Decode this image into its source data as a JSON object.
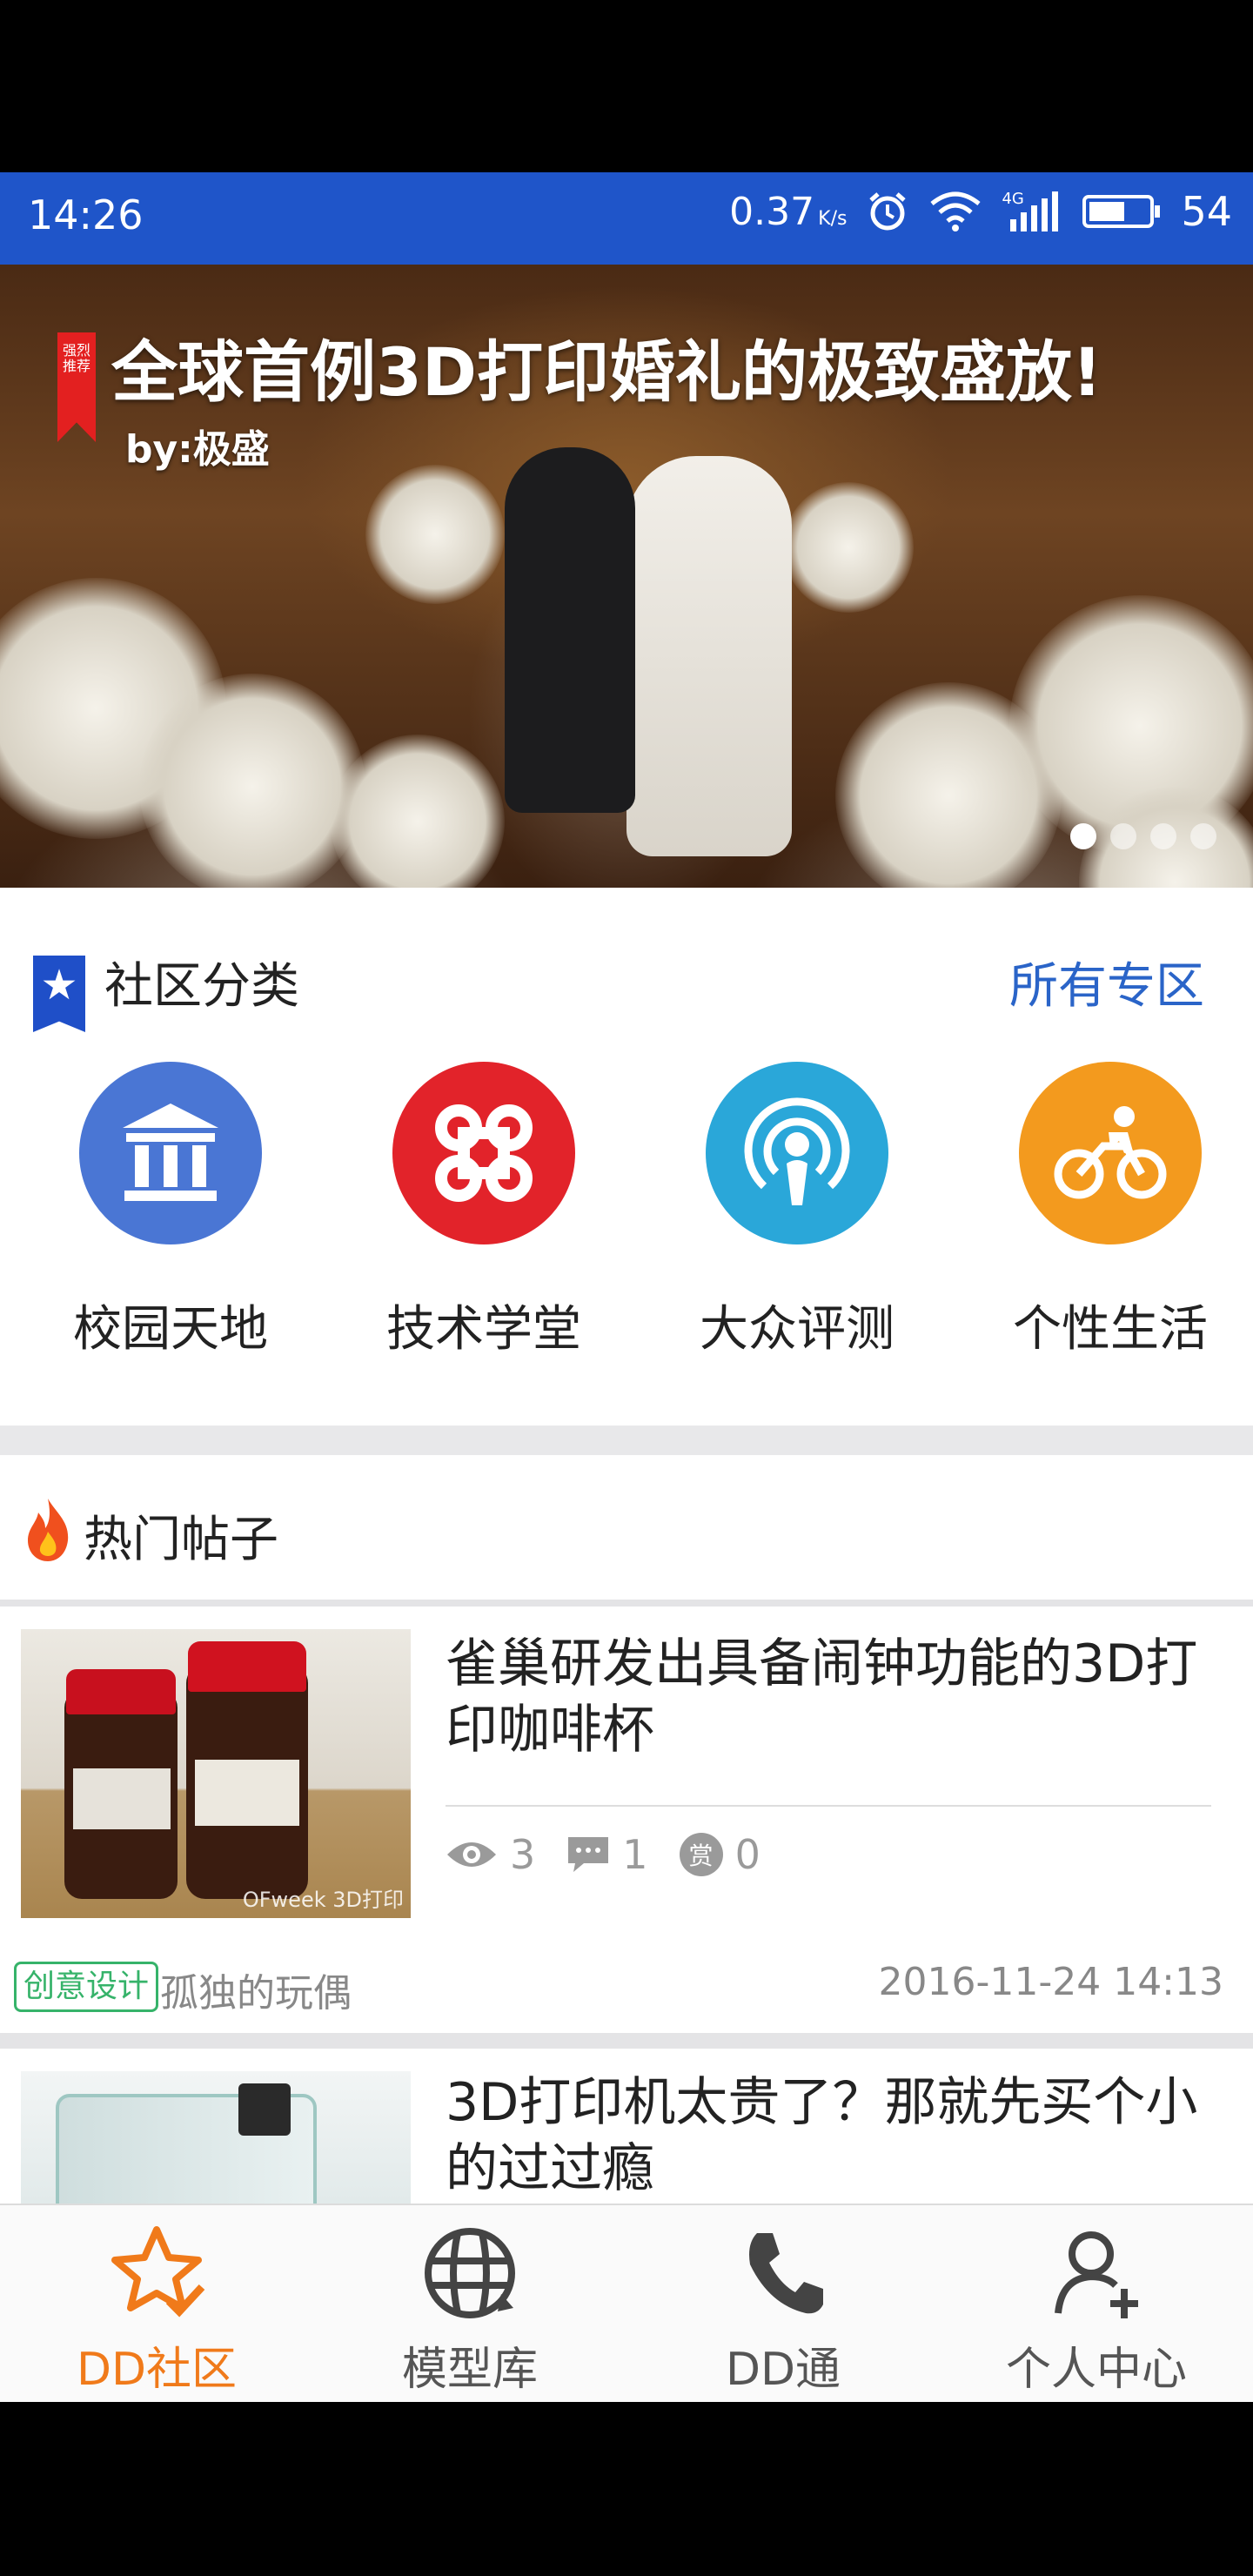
{
  "status_bar": {
    "time": "14:26",
    "net_speed": "0.37",
    "net_unit": "K/s",
    "signal_label": "4G",
    "battery": "54"
  },
  "banner": {
    "badge": "强烈推荐",
    "title": "全球首例3D打印婚礼的极致盛放!",
    "author": "by:极盛",
    "dots_total": 4,
    "dots_active_index": 0
  },
  "community": {
    "title": "社区分类",
    "all_link": "所有专区",
    "categories": [
      {
        "label": "校园天地",
        "icon": "pillar-building-icon",
        "color": "#4a76d4"
      },
      {
        "label": "技术学堂",
        "icon": "command-key-icon",
        "color": "#e2232a"
      },
      {
        "label": "大众评测",
        "icon": "podcast-icon",
        "color": "#2aa7d9"
      },
      {
        "label": "个性生活",
        "icon": "cyclist-icon",
        "color": "#f39a1e"
      }
    ]
  },
  "hot_posts": {
    "title": "热门帖子",
    "posts": [
      {
        "title": "雀巢研发出具备闹钟功能的3D打印咖啡杯",
        "views": "3",
        "comments": "1",
        "rewards": "0",
        "reward_glyph": "赏",
        "tag": "创意设计",
        "author": "孤独的玩偶",
        "date": "2016-11-24 14:13",
        "thumb_watermark": "OFweek 3D打印"
      },
      {
        "title": "3D打印机太贵了？那就先买个小的过过瘾"
      }
    ]
  },
  "bottom_nav": {
    "tabs": [
      {
        "label": "DD社区",
        "icon": "star-check-icon",
        "active": true
      },
      {
        "label": "模型库",
        "icon": "globe-grid-icon",
        "active": false
      },
      {
        "label": "DD通",
        "icon": "phone-icon",
        "active": false
      },
      {
        "label": "个人中心",
        "icon": "user-add-icon",
        "active": false
      }
    ]
  },
  "colors": {
    "status_bar": "#1f55c9",
    "accent_orange": "#f07a1a",
    "link_blue": "#2a64c8",
    "tag_green": "#36b36a"
  }
}
